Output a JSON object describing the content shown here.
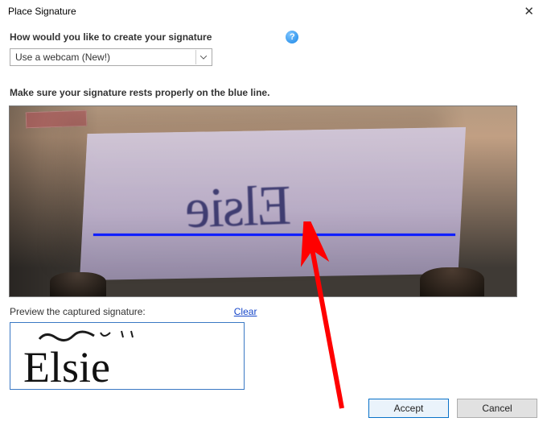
{
  "window": {
    "title": "Place Signature"
  },
  "form": {
    "create_label": "How would you like to create your signature",
    "dropdown_value": "Use a webcam (New!)"
  },
  "instruction": "Make sure your signature rests properly on the blue line.",
  "camera": {
    "signature_text": "Elsie"
  },
  "preview": {
    "label": "Preview the captured signature:",
    "clear_link": "Clear",
    "signature_text": "Elsie"
  },
  "buttons": {
    "accept": "Accept",
    "cancel": "Cancel"
  }
}
